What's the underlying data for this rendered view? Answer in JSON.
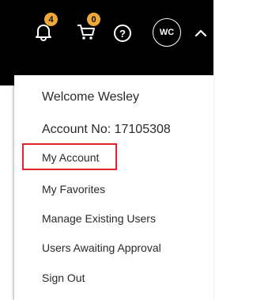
{
  "header": {
    "notifications": {
      "icon": "bell-icon",
      "count": "4"
    },
    "cart": {
      "icon": "cart-icon",
      "count": "0"
    },
    "help": {
      "icon": "question-circle-icon",
      "glyph": "?"
    },
    "avatar": {
      "initials": "WC"
    },
    "caret": {
      "icon": "chevron-up-icon"
    },
    "badge_color": "#f0a83a"
  },
  "menu": {
    "welcome": "Welcome Wesley",
    "account_no": "Account No: 17105308",
    "items": [
      {
        "label": "My Account",
        "highlighted": true
      },
      {
        "label": "My Favorites"
      },
      {
        "label": "Manage Existing Users"
      },
      {
        "label": "Users Awaiting Approval"
      },
      {
        "label": "Sign Out"
      }
    ],
    "highlight_color": "#e3232c"
  }
}
